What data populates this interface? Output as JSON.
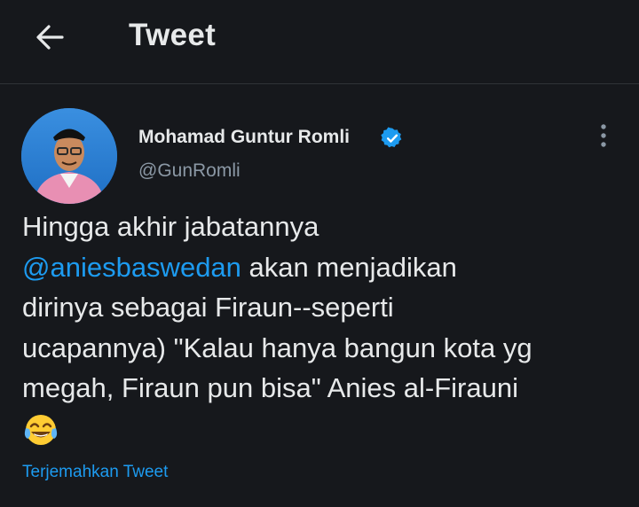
{
  "header": {
    "title": "Tweet",
    "back_icon": "arrow-left-icon"
  },
  "author": {
    "display_name": "Mohamad Guntur Romli",
    "handle": "@GunRomli",
    "verified": true
  },
  "tweet": {
    "line1": "Hingga akhir jabatannya",
    "mention": "@aniesbaswedan",
    "line2_rest": " akan menjadikan",
    "line3": "dirinya sebagai Firaun--seperti",
    "line4": "ucapannya) \"Kalau hanya bangun kota yg",
    "line5": "megah, Firaun pun bisa\" Anies al-Firauni",
    "emoji": "face-with-tears-of-joy"
  },
  "translate_label": "Terjemahkan Tweet",
  "colors": {
    "background": "#16181c",
    "text": "#e7e9ea",
    "secondary": "#8b98a5",
    "accent": "#1d9bf0"
  }
}
